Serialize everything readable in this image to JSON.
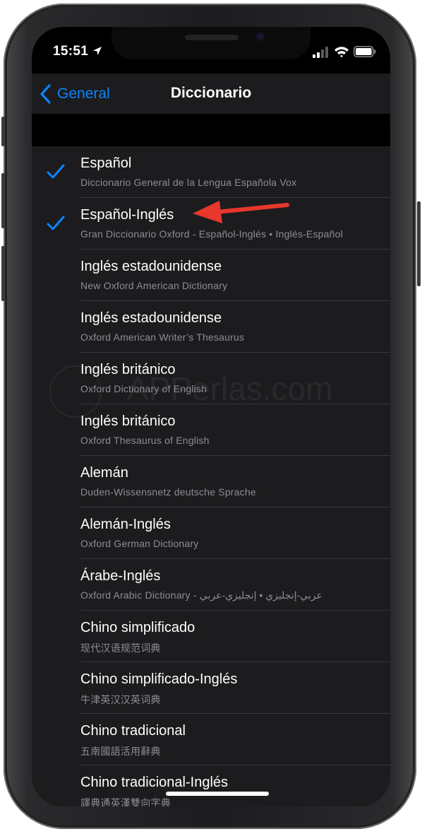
{
  "status_bar": {
    "time": "15:51"
  },
  "nav": {
    "back_label": "General",
    "title": "Diccionario"
  },
  "watermark": "APPerlas.com",
  "dictionaries": [
    {
      "title": "Español",
      "subtitle": "Diccionario General de la Lengua Española Vox",
      "checked": true
    },
    {
      "title": "Español-Inglés",
      "subtitle": "Gran Diccionario Oxford - Español-Inglés • Inglés-Español",
      "checked": true
    },
    {
      "title": "Inglés estadounidense",
      "subtitle": "New Oxford American Dictionary",
      "checked": false
    },
    {
      "title": "Inglés estadounidense",
      "subtitle": "Oxford American Writer’s Thesaurus",
      "checked": false
    },
    {
      "title": "Inglés británico",
      "subtitle": "Oxford Dictionary of English",
      "checked": false
    },
    {
      "title": "Inglés británico",
      "subtitle": "Oxford Thesaurus of English",
      "checked": false
    },
    {
      "title": "Alemán",
      "subtitle": "Duden-Wissensnetz deutsche Sprache",
      "checked": false
    },
    {
      "title": "Alemán-Inglés",
      "subtitle": "Oxford German Dictionary",
      "checked": false
    },
    {
      "title": "Árabe-Inglés",
      "subtitle": "Oxford Arabic Dictionary - عربي-إنجليزي • إنجليزي-عربي",
      "checked": false
    },
    {
      "title": "Chino simplificado",
      "subtitle": "现代汉语规范词典",
      "checked": false
    },
    {
      "title": "Chino simplificado-Inglés",
      "subtitle": "牛津英汉汉英词典",
      "checked": false
    },
    {
      "title": "Chino tradicional",
      "subtitle": "五南國語活用辭典",
      "checked": false
    },
    {
      "title": "Chino tradicional-Inglés",
      "subtitle": "譯典通英漢雙向字典",
      "checked": false
    }
  ],
  "colors": {
    "accent": "#0a84ff",
    "annotation_arrow": "#e8372c",
    "cell_background": "#1c1c1e",
    "separator": "#38383a"
  }
}
